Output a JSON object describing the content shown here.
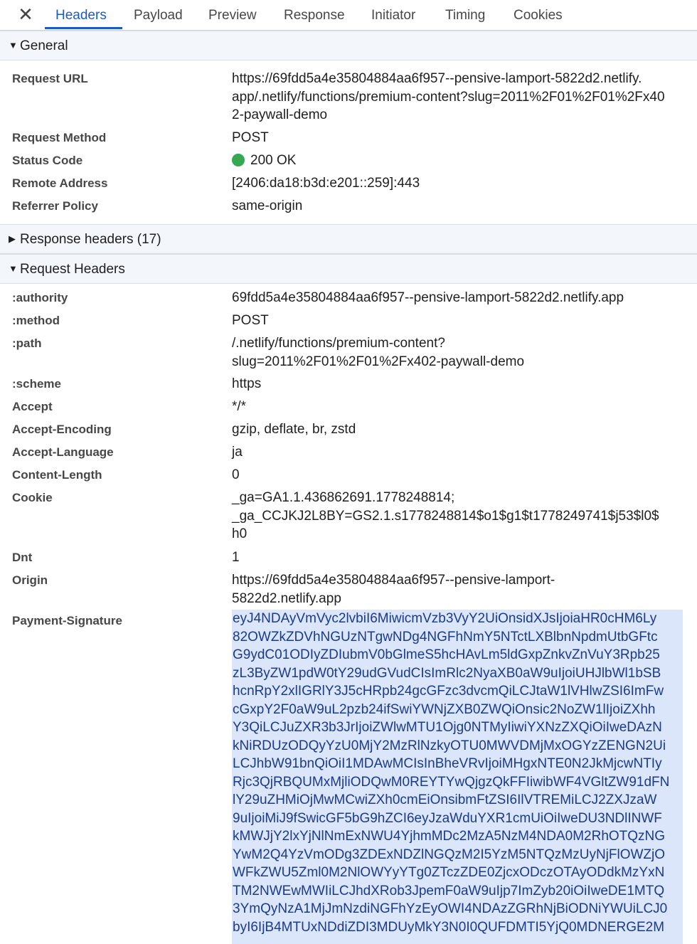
{
  "tabs": [
    {
      "label": "Headers",
      "active": true
    },
    {
      "label": "Payload",
      "active": false
    },
    {
      "label": "Preview",
      "active": false
    },
    {
      "label": "Response",
      "active": false
    },
    {
      "label": "Initiator",
      "active": false
    },
    {
      "label": "Timing",
      "active": false
    },
    {
      "label": "Cookies",
      "active": false
    }
  ],
  "general": {
    "title": "General",
    "rows": [
      {
        "key": "Request URL",
        "value": "https://69fdd5a4e35804884aa6f957--pensive-lamport-5822d2.netlify.\napp/.netlify/functions/premium-content?slug=2011%2F01%2F01%2Fx40\n2-paywall-demo"
      },
      {
        "key": "Request Method",
        "value": "POST"
      },
      {
        "key": "Status Code",
        "value": "200 OK"
      },
      {
        "key": "Remote Address",
        "value": "[2406:da18:b3d:e201::259]:443"
      },
      {
        "key": "Referrer Policy",
        "value": "same-origin"
      }
    ]
  },
  "response_headers": {
    "title": "Response headers (17)"
  },
  "request_headers": {
    "title": "Request Headers",
    "rows": [
      {
        "key": ":authority",
        "value": "69fdd5a4e35804884aa6f957--pensive-lamport-5822d2.netlify.app"
      },
      {
        "key": ":method",
        "value": "POST"
      },
      {
        "key": ":path",
        "value": "/.netlify/functions/premium-content?\nslug=2011%2F01%2F01%2Fx402-paywall-demo"
      },
      {
        "key": ":scheme",
        "value": "https"
      },
      {
        "key": "Accept",
        "value": "*/*"
      },
      {
        "key": "Accept-Encoding",
        "value": "gzip, deflate, br, zstd"
      },
      {
        "key": "Accept-Language",
        "value": "ja"
      },
      {
        "key": "Content-Length",
        "value": "0"
      },
      {
        "key": "Cookie",
        "value": "_ga=GA1.1.436862691.1778248814;\n_ga_CCJKJ2L8BY=GS2.1.s1778248814$o1$g1$t1778249741$j53$l0$\nh0"
      },
      {
        "key": "Dnt",
        "value": "1"
      },
      {
        "key": "Origin",
        "value": "https://69fdd5a4e35804884aa6f957--pensive-lamport-\n5822d2.netlify.app"
      },
      {
        "key": "Payment-Signature",
        "value_lines": [
          "eyJ4NDAyVmVyc2lvbiI6MiwicmVzb3VyY2UiOnsidXJsIjoiaHR0cHM6Ly",
          "82OWZkZDVhNGUzNTgwNDg4NGFhNmY5NTctLXBlbnNpdmUtbGFtc",
          "G9ydC01ODIyZDIubmV0bGlmeS5hcHAvLm5ldGxpZnkvZnVuY3Rpb25",
          "zL3ByZW1pdW0tY29udGVudCIsImRlc2NyaXB0aW9uIjoiUHJlbWl1bSB",
          "hcnRpY2xlIGRlY3J5cHRpb24gcGFzc3dvcmQiLCJtaW1lVHlwZSI6ImFw",
          "cGxpY2F0aW9uL2pzb24ifSwiYWNjZXB0ZWQiOnsic2NoZW1lIjoiZXhh",
          "Y3QiLCJuZXR3b3JrIjoiZWlwMTU1Ojg0NTMyIiwiYXNzZXQiOiIweDAzN",
          "kNiRDUzODQyYzU0MjY2MzRlNzkyOTU0MWVDMjMxOGYzZENGN2Ui",
          "LCJhbW91bnQiOiI1MDAwMCIsInBheVRvIjoiMHgxNTE0N2JkMjcwNTIy",
          "Rjc3QjRBQUMxMjliODQwM0REYTYwQjgzQkFFIiwibWF4VGltZW91dFN",
          "lY29uZHMiOjMwMCwiZXh0cmEiOnsibmFtZSI6IlVTREMiLCJ2ZXJzaW",
          "9uIjoiMiJ9fSwicGF5bG9hZCI6eyJzaWduYXR1cmUiOiIweDU3NDlINWF",
          "kMWJjY2lxYjNlNmExNWU4YjhmMDc2MzA5NzM4NDA0M2RhOTQzNG",
          "YwM2Q4YzVmODg3ZDExNDZlNGQzM2I5YzM5NTQzMzUyNjFlOWZjO",
          "WFkZWU5Zml0M2NlOWYyYTg0ZTczZDE0ZjcxODczOTAyODdkMzYxN",
          "TM2NWEwMWIiLCJhdXRob3JpemF0aW9uIjp7ImZyb20iOiIweDE1MTQ",
          "3YmQyNzA1MjJmNzdiNGFhYzEyOWI4NDAzZGRhNjBiODNiYWUiLCJ0",
          "byI6IjB4MTUxNDdiZDI3MDUyMkY3N0I0QUFDMTI5YjQ0MDNERGE2M"
        ]
      }
    ]
  }
}
